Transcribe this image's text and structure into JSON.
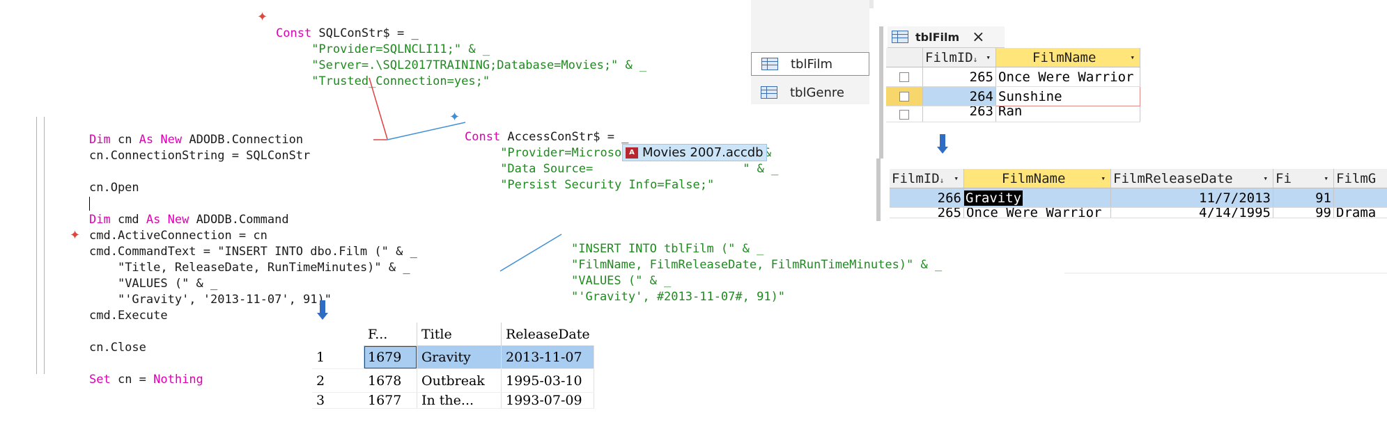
{
  "sql_const": {
    "l1_kw": "Const",
    "l1_rest": " SQLConStr$ = _",
    "l2": "\"Provider=SQLNCLI11;\" & _",
    "l3": "\"Server=.\\SQL2017TRAINING;Database=Movies;\" & _",
    "l4": "\"Trusted_Connection=yes;\""
  },
  "access_const": {
    "l1_kw": "Const",
    "l1_rest": " AccessConStr$ = _",
    "l2": "\"Provider=Microsoft.ACE.OLEDB.12.0;\" &",
    "l3a": "\"Data Source=",
    "file_name": "Movies 2007.accdb",
    "l3b": " \" & _",
    "l4": "\"Persist Security Info=False;\""
  },
  "main_code": {
    "dim_kw": "Dim",
    "cn_name": " cn ",
    "as_new": "As New",
    "cn_type": " ADODB.Connection",
    "connstr": "cn.ConnectionString = SQLConStr",
    "open": "cn.Open",
    "cmd_name": " cmd ",
    "cmd_type": " ADODB.Command",
    "active": "cmd.ActiveConnection = cn",
    "cmdtext": "cmd.CommandText = \"INSERT INTO dbo.Film (\" & _",
    "cmdtext2": "\"Title, ReleaseDate, RunTimeMinutes)\" & _",
    "cmdtext3": "\"VALUES (\" & _",
    "cmdtext4": "\"'Gravity', '2013-11-07', 91)\"",
    "execute": "cmd.Execute",
    "close": "cn.Close",
    "set_kw": "Set",
    "set_mid": " cn = ",
    "nothing_kw": "Nothing"
  },
  "access_sql": {
    "l1": "\"INSERT INTO tblFilm (\" & _",
    "l2": "\"FilmName, FilmReleaseDate, FilmRunTimeMinutes)\" & _",
    "l3": "\"VALUES (\" & _",
    "l4": "\"'Gravity', #2013-11-07#, 91)\""
  },
  "sql_result": {
    "headers": [
      "F...",
      "Title",
      "ReleaseDate"
    ],
    "rows": [
      [
        "1",
        "1679",
        "Gravity",
        "2013-11-07"
      ],
      [
        "2",
        "1678",
        "Outbreak",
        "1995-03-10"
      ],
      [
        "3",
        "1677",
        "In the...",
        "1993-07-09"
      ]
    ]
  },
  "nav_pane": {
    "items": [
      "tblFilm",
      "tblGenre"
    ]
  },
  "access_tab": {
    "title": "tblFilm",
    "close": "×"
  },
  "access_before": {
    "headers": [
      "FilmID",
      "FilmName"
    ],
    "rows": [
      [
        "265",
        "Once Were Warrior"
      ],
      [
        "264",
        "Sunshine"
      ],
      [
        "263",
        "Ran"
      ]
    ]
  },
  "access_after": {
    "headers": [
      "FilmID",
      "FilmName",
      "FilmReleaseDate",
      "Fi",
      "FilmG"
    ],
    "rows": [
      [
        "266",
        "Gravity",
        "11/7/2013",
        "91",
        ""
      ],
      [
        "265",
        "Once Were Warrior",
        "4/14/1995",
        "99",
        "Drama"
      ]
    ]
  },
  "colors": {
    "keyword": "#e000b4",
    "string": "#1f8a1f",
    "selection": "#a9cdf0",
    "header_gold": "#ffe57a",
    "arrow": "#2f6dc4"
  }
}
